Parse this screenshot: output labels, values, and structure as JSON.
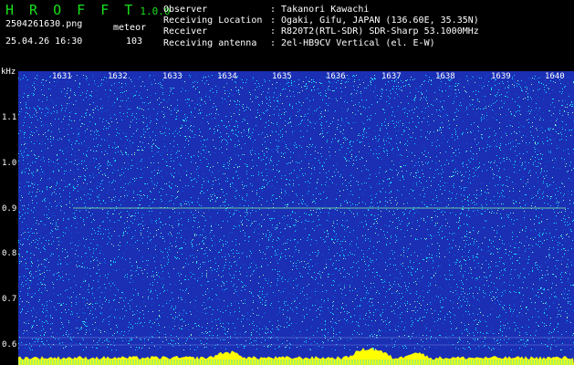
{
  "app": {
    "name": "H R O F F T",
    "version": "1.0.0"
  },
  "file": {
    "name": "2504261630.png",
    "mode": "meteor",
    "datetime": "25.04.26 16:30",
    "count": "103"
  },
  "info": [
    {
      "key": "Observer",
      "value": ": Takanori Kawachi"
    },
    {
      "key": "Receiving Location",
      "value": ": Ogaki, Gifu, JAPAN (136.60E, 35.35N)"
    },
    {
      "key": "Receiver",
      "value": ": R820T2(RTL-SDR) SDR-Sharp 53.1000MHz"
    },
    {
      "key": "Receiving antenna",
      "value": ": 2el-HB9CV Vertical (el. E-W)"
    }
  ],
  "axis": {
    "y_unit": "kHz",
    "y_ticks": [
      "1.1",
      "1.0",
      "0.9",
      "0.8",
      "0.7",
      "0.6"
    ],
    "x_ticks": [
      "1631",
      "1632",
      "1633",
      "1634",
      "1635",
      "1636",
      "1637",
      "1638",
      "1639",
      "1640"
    ]
  },
  "colors": {
    "background": "#1a2fb4",
    "noise_cyan": "#19d8ff",
    "signal": "#ffff00",
    "logo": "#19e019"
  }
}
